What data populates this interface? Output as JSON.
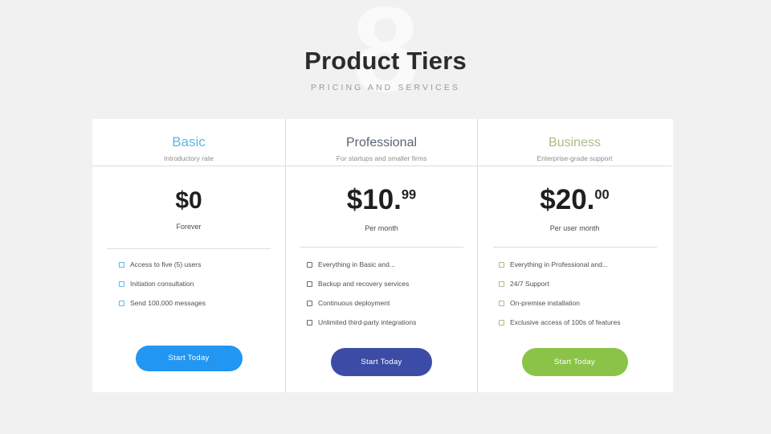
{
  "header": {
    "watermark": "8",
    "title": "Product Tiers",
    "subtitle": "PRICING AND SERVICES"
  },
  "colors": {
    "background": "#f1f1f1",
    "card": "#ffffff",
    "divider": "#dcdcdc",
    "basic_accent": "#5cb7e7",
    "professional_accent": "#5a6374",
    "business_accent": "#a8bd84",
    "basic_button": "#2196f3",
    "professional_button": "#3c4ca6",
    "business_button": "#8bc348"
  },
  "plans": [
    {
      "name": "Basic",
      "tagline": "Introductory rate",
      "price": "$0",
      "cents": "",
      "period": "Forever",
      "features": [
        "Access to five (5) users",
        "Initiation consultation",
        "Send 100,000 messages"
      ],
      "cta": "Start Today"
    },
    {
      "name": "Professional",
      "tagline": "For startups and smaller firms",
      "price": "$10.",
      "cents": "99",
      "period": "Per month",
      "features": [
        "Everything in Basic and...",
        "Backup and recovery services",
        "Continuous deployment",
        "Unlimited third-party integrations"
      ],
      "cta": "Start Today"
    },
    {
      "name": "Business",
      "tagline": "Enterprise-grade support",
      "price": "$20.",
      "cents": "00",
      "period": "Per user month",
      "features": [
        "Everything in Professional and...",
        "24/7 Support",
        "On-premise installation",
        "Exclusive access of 100s of features"
      ],
      "cta": "Start Today"
    }
  ]
}
